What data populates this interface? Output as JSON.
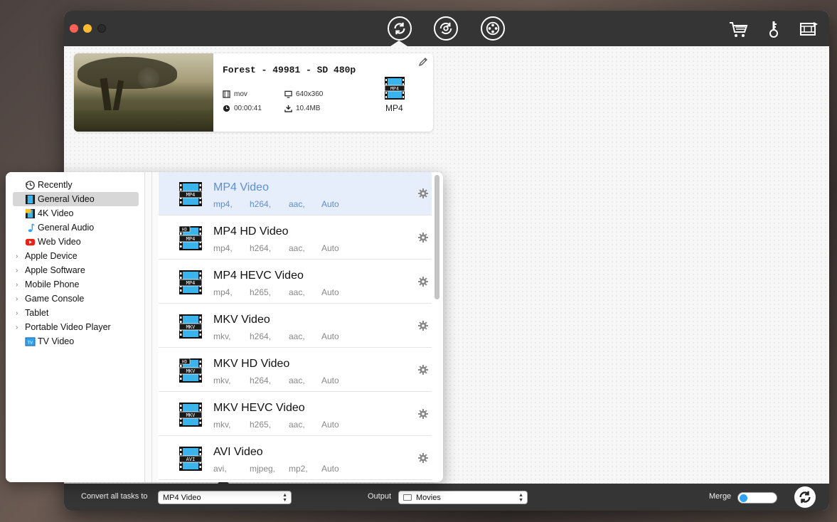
{
  "window": {
    "mode_buttons": [
      {
        "name": "convert-mode",
        "icon": "convert-arrows-icon"
      },
      {
        "name": "rotate-mode",
        "icon": "rotate-icon"
      },
      {
        "name": "film-mode",
        "icon": "film-reel-icon"
      }
    ],
    "right_icons": [
      "cart-icon",
      "key-icon",
      "video-settings-icon"
    ]
  },
  "task": {
    "title": "Forest - 49981 - SD 480p",
    "container": "mov",
    "resolution": "640x360",
    "duration": "00:00:41",
    "size": "10.4MB",
    "output_format": "MP4",
    "output_badge": "MP4"
  },
  "categories": [
    {
      "label": "Recently",
      "icon": "history-icon",
      "expandable": false,
      "selected": false
    },
    {
      "label": "General Video",
      "icon": "film-icon",
      "expandable": false,
      "selected": true
    },
    {
      "label": "4K Video",
      "icon": "4k-film-icon",
      "expandable": false,
      "selected": false
    },
    {
      "label": "General Audio",
      "icon": "music-note-icon",
      "expandable": false,
      "selected": false
    },
    {
      "label": "Web Video",
      "icon": "youtube-icon",
      "expandable": false,
      "selected": false
    },
    {
      "label": "Apple Device",
      "icon": "",
      "expandable": true,
      "selected": false
    },
    {
      "label": "Apple Software",
      "icon": "",
      "expandable": true,
      "selected": false
    },
    {
      "label": "Mobile Phone",
      "icon": "",
      "expandable": true,
      "selected": false
    },
    {
      "label": "Game Console",
      "icon": "",
      "expandable": true,
      "selected": false
    },
    {
      "label": "Tablet",
      "icon": "",
      "expandable": true,
      "selected": false
    },
    {
      "label": "Portable Video Player",
      "icon": "",
      "expandable": true,
      "selected": false
    },
    {
      "label": "TV Video",
      "icon": "tv-icon",
      "expandable": false,
      "selected": false
    }
  ],
  "formats": [
    {
      "name": "MP4 Video",
      "badge": "MP4",
      "hd": false,
      "specs": [
        "mp4,",
        "h264,",
        "aac,",
        "Auto"
      ],
      "selected": true
    },
    {
      "name": "MP4 HD Video",
      "badge": "MP4",
      "hd": true,
      "specs": [
        "mp4,",
        "h264,",
        "aac,",
        "Auto"
      ],
      "selected": false
    },
    {
      "name": "MP4 HEVC Video",
      "badge": "MP4",
      "hd": false,
      "specs": [
        "mp4,",
        "h265,",
        "aac,",
        "Auto"
      ],
      "selected": false
    },
    {
      "name": "MKV Video",
      "badge": "MKV",
      "hd": false,
      "specs": [
        "mkv,",
        "h264,",
        "aac,",
        "Auto"
      ],
      "selected": false
    },
    {
      "name": "MKV HD Video",
      "badge": "MKV",
      "hd": true,
      "specs": [
        "mkv,",
        "h264,",
        "aac,",
        "Auto"
      ],
      "selected": false
    },
    {
      "name": "MKV HEVC Video",
      "badge": "MKV",
      "hd": false,
      "specs": [
        "mkv,",
        "h265,",
        "aac,",
        "Auto"
      ],
      "selected": false
    },
    {
      "name": "AVI Video",
      "badge": "AVI",
      "hd": false,
      "specs": [
        "avi,",
        "mjpeg,",
        "mp2,",
        "Auto"
      ],
      "selected": false
    }
  ],
  "bottom": {
    "convert_label": "Convert all tasks to",
    "convert_value": "MP4 Video",
    "output_label": "Output",
    "output_value": "Movies",
    "merge_label": "Merge",
    "merge_on": false
  },
  "colors": {
    "accent": "#2ea3f2",
    "selected_row": "#e6eefc",
    "selected_text": "#5b8fd6",
    "titlebar": "#353535"
  }
}
